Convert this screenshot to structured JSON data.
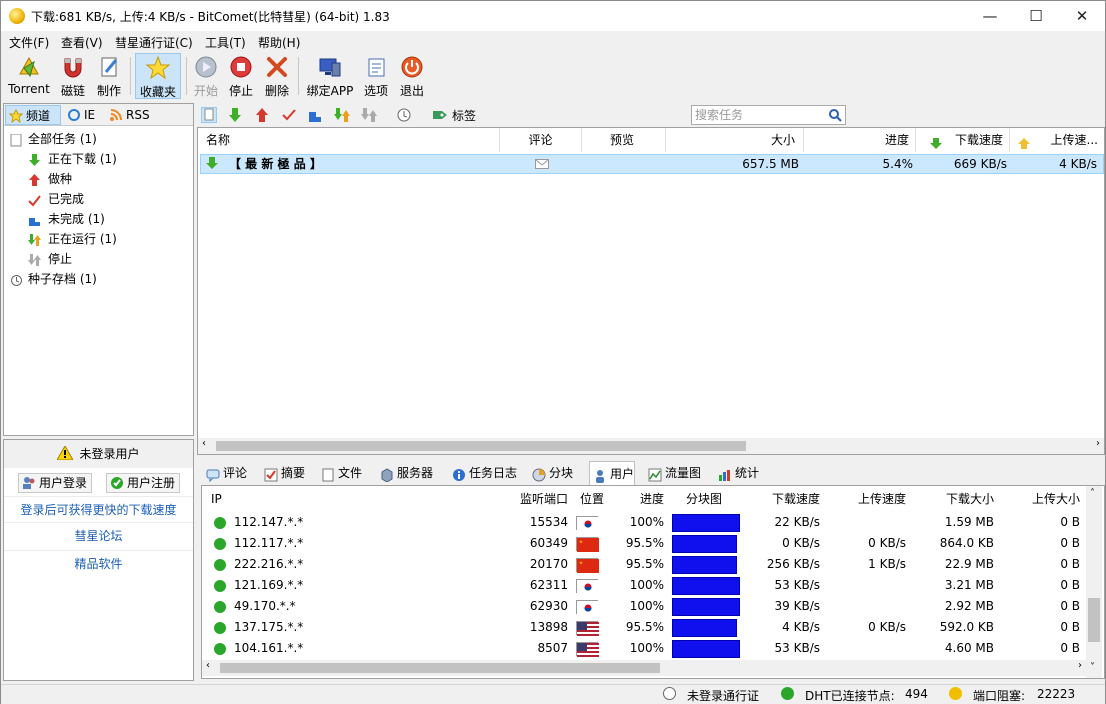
{
  "window": {
    "title": "下载:681 KB/s, 上传:4 KB/s - BitComet(比特彗星) (64-bit) 1.83",
    "minimize": "—",
    "maximize": "☐",
    "close": "✕"
  },
  "menu": [
    "文件(F)",
    "查看(V)",
    "彗星通行证(C)",
    "工具(T)",
    "帮助(H)"
  ],
  "toolbar": {
    "torrent": "Torrent",
    "magnet": "磁链",
    "make": "制作",
    "favorites": "收藏夹",
    "start": "开始",
    "stop": "停止",
    "delete": "删除",
    "bind_app": "绑定APP",
    "options": "选项",
    "exit": "退出"
  },
  "left_tabs": {
    "channel": "频道",
    "ie": "IE",
    "rss": "RSS"
  },
  "tree": {
    "all": "全部任务 (1)",
    "downloading": "正在下载 (1)",
    "seeding": "做种",
    "completed": "已完成",
    "incomplete": "未完成 (1)",
    "running": "正在运行 (1)",
    "stopped": "停止",
    "archive": "种子存档 (1)"
  },
  "user_panel": {
    "status": "未登录用户",
    "login": "用户登录",
    "register": "用户注册",
    "link1": "登录后可获得更快的下载速度",
    "link2": "彗星论坛",
    "link3": "精品软件"
  },
  "task_toolbar": {
    "tags": "标签",
    "search_placeholder": "搜索任务"
  },
  "task_columns": {
    "name": "名称",
    "comment": "评论",
    "preview": "预览",
    "size": "大小",
    "progress": "进度",
    "down_speed": "下载速度",
    "up_speed": "上传速..."
  },
  "task": {
    "name": "【 最 新 極 品 】",
    "size": "657.5 MB",
    "progress": "5.4%",
    "down_speed": "669 KB/s",
    "up_speed": "4 KB/s"
  },
  "detail_tabs": {
    "comment": "评论",
    "summary": "摘要",
    "files": "文件",
    "trackers": "服务器",
    "log": "任务日志",
    "pieces": "分块",
    "peers": "用户",
    "traffic": "流量图",
    "stats": "统计"
  },
  "peer_columns": {
    "ip": "IP",
    "port": "监听端口",
    "location": "位置",
    "progress": "进度",
    "piece_map": "分块图",
    "down_speed": "下载速度",
    "up_speed": "上传速度",
    "down_size": "下载大小",
    "up_size": "上传大小"
  },
  "peers": [
    {
      "ip": "112.147.*.*",
      "port": "15534",
      "flag": "kr",
      "progress": "100%",
      "fill": 1.0,
      "down_speed": "22 KB/s",
      "up_speed": "",
      "down_size": "1.59 MB",
      "up_size": "0 B"
    },
    {
      "ip": "112.117.*.*",
      "port": "60349",
      "flag": "cn",
      "progress": "95.5%",
      "fill": 0.955,
      "down_speed": "0 KB/s",
      "up_speed": "0 KB/s",
      "down_size": "864.0 KB",
      "up_size": "0 B"
    },
    {
      "ip": "222.216.*.*",
      "port": "20170",
      "flag": "cn",
      "progress": "95.5%",
      "fill": 0.955,
      "down_speed": "256 KB/s",
      "up_speed": "1 KB/s",
      "down_size": "22.9 MB",
      "up_size": "0 B"
    },
    {
      "ip": "121.169.*.*",
      "port": "62311",
      "flag": "kr",
      "progress": "100%",
      "fill": 1.0,
      "down_speed": "53 KB/s",
      "up_speed": "",
      "down_size": "3.21 MB",
      "up_size": "0 B"
    },
    {
      "ip": "49.170.*.*",
      "port": "62930",
      "flag": "kr",
      "progress": "100%",
      "fill": 1.0,
      "down_speed": "39 KB/s",
      "up_speed": "",
      "down_size": "2.92 MB",
      "up_size": "0 B"
    },
    {
      "ip": "137.175.*.*",
      "port": "13898",
      "flag": "us",
      "progress": "95.5%",
      "fill": 0.955,
      "down_speed": "4 KB/s",
      "up_speed": "0 KB/s",
      "down_size": "592.0 KB",
      "up_size": "0 B"
    },
    {
      "ip": "104.161.*.*",
      "port": "8507",
      "flag": "us",
      "progress": "100%",
      "fill": 1.0,
      "down_speed": "53 KB/s",
      "up_speed": "",
      "down_size": "4.60 MB",
      "up_size": "0 B"
    }
  ],
  "statusbar": {
    "passport": "未登录通行证",
    "dht_label": "DHT已连接节点:",
    "dht_value": "494",
    "port_label": "端口阻塞:",
    "port_value": "22223"
  },
  "colors": {
    "accent": "#cce4f7",
    "selection": "#cce8ff",
    "piece_bar": "#1010ee",
    "link": "#1a5fb4",
    "peer_dot": "#2aa72a"
  }
}
